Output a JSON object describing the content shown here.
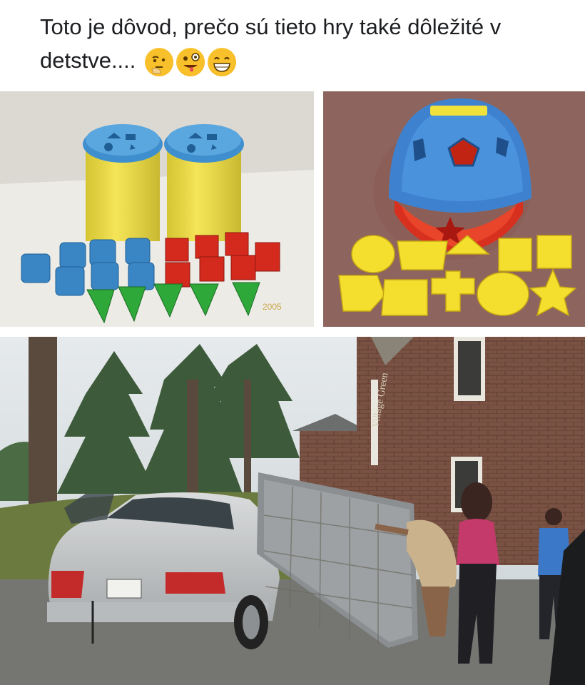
{
  "post": {
    "text": "Toto je dôvod, prečo sú tieto hry také dôležité v detstve....",
    "emojis": [
      "thinking-face-emoji",
      "zany-face-emoji",
      "grinning-face-emoji"
    ]
  },
  "photos": {
    "sorter_cans": {
      "watermark": "2005"
    },
    "sorter_ball": {},
    "mattress": {
      "sign": "Village Green"
    }
  },
  "colors": {
    "text": "#1c1e21",
    "toy_blue": "#3f8fcf",
    "toy_yellow": "#f4e03a",
    "toy_red": "#d42a1e",
    "toy_green": "#2fa83a"
  }
}
